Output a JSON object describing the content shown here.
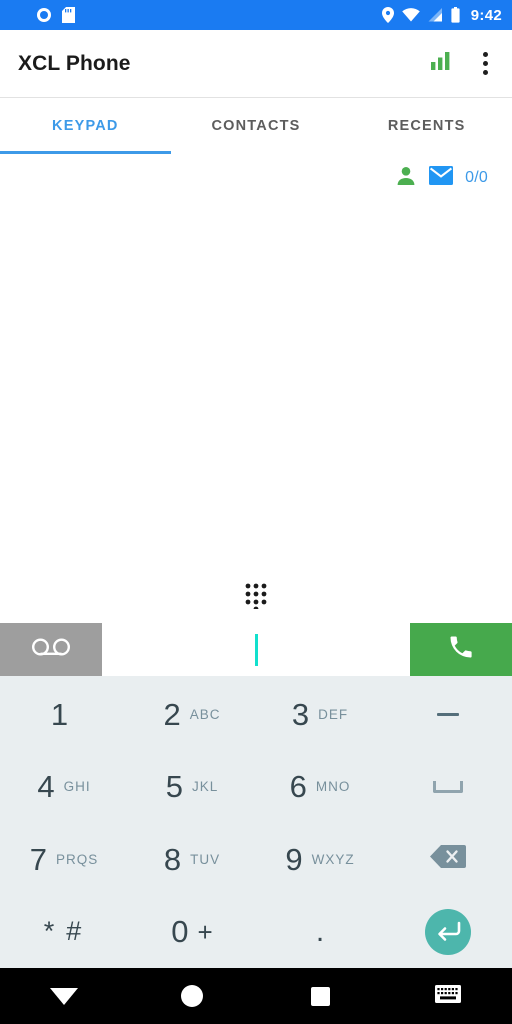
{
  "status_bar": {
    "background": "#1a7bf2",
    "time": "9:42",
    "left_icons": [
      "record-circle-icon",
      "sd-card-icon"
    ],
    "right_icons": [
      "location-pin-icon",
      "wifi-icon",
      "cellular-signal-icon",
      "battery-icon"
    ]
  },
  "app_bar": {
    "title": "XCL Phone",
    "signal_icon": "signal-bars-icon",
    "signal_color": "#4caf50",
    "overflow_icon": "overflow-menu-icon"
  },
  "tabs": {
    "active_index": 0,
    "accent": "#3d9ae8",
    "items": [
      {
        "label": "KEYPAD"
      },
      {
        "label": "CONTACTS"
      },
      {
        "label": "RECENTS"
      }
    ]
  },
  "sub_row": {
    "person_icon": "person-icon",
    "person_color": "#4caf50",
    "mail_icon": "mail-icon",
    "mail_color": "#2196f3",
    "count": "0/0",
    "count_color": "#3d9ae8"
  },
  "content": {
    "dialpad_toggle_icon": "dialpad-icon"
  },
  "input_row": {
    "voicemail_icon": "voicemail-icon",
    "voicemail_bg": "#9e9e9e",
    "number_value": "",
    "number_placeholder": "",
    "caret_color": "#12e0cd",
    "call_icon": "phone-call-icon",
    "call_bg": "#46a94c"
  },
  "keypad": {
    "background": "#e9eef0",
    "digit_color": "#37474f",
    "letter_color": "#78909c",
    "enter_bg": "#4db6ac",
    "rows": [
      [
        {
          "digit": "1",
          "letters": "",
          "type": "digit"
        },
        {
          "digit": "2",
          "letters": "ABC",
          "type": "digit"
        },
        {
          "digit": "3",
          "letters": "DEF",
          "type": "digit"
        },
        {
          "digit": "",
          "letters": "",
          "type": "dash",
          "icon": "dash-icon"
        }
      ],
      [
        {
          "digit": "4",
          "letters": "GHI",
          "type": "digit"
        },
        {
          "digit": "5",
          "letters": "JKL",
          "type": "digit"
        },
        {
          "digit": "6",
          "letters": "MNO",
          "type": "digit"
        },
        {
          "digit": "",
          "letters": "",
          "type": "space",
          "icon": "spacebar-icon"
        }
      ],
      [
        {
          "digit": "7",
          "letters": "PRQS",
          "type": "digit"
        },
        {
          "digit": "8",
          "letters": "TUV",
          "type": "digit"
        },
        {
          "digit": "9",
          "letters": "WXYZ",
          "type": "digit"
        },
        {
          "digit": "",
          "letters": "",
          "type": "backspace",
          "icon": "backspace-icon"
        }
      ],
      [
        {
          "digit": "*",
          "letters": "#",
          "type": "star"
        },
        {
          "digit": "0",
          "letters": "+",
          "type": "zero"
        },
        {
          "digit": ".",
          "letters": "",
          "type": "period"
        },
        {
          "digit": "",
          "letters": "",
          "type": "enter",
          "icon": "enter-icon"
        }
      ]
    ]
  },
  "nav_bar": {
    "background": "#000000",
    "back_icon": "back-triangle-icon",
    "home_icon": "home-circle-icon",
    "recents_icon": "recents-square-icon",
    "keyboard_icon": "keyboard-icon"
  }
}
